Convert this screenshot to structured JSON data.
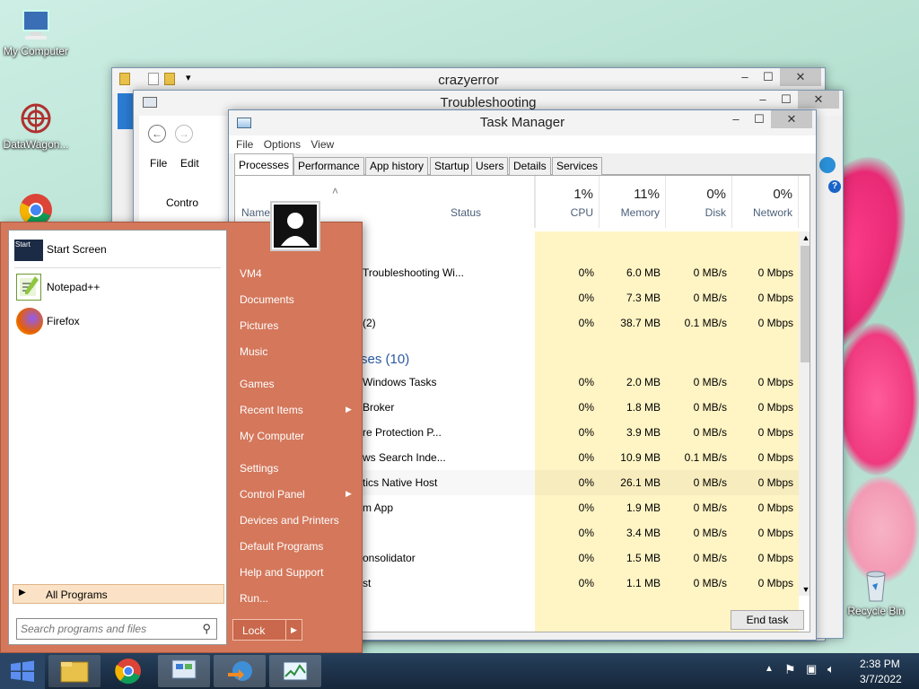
{
  "desktop": {
    "icons": [
      {
        "label": "My Computer",
        "icon": "computer-icon"
      },
      {
        "label": "DataWagon...",
        "icon": "datawagon-icon"
      },
      {
        "label": "",
        "icon": "chrome-icon"
      },
      {
        "label": "Recycle Bin",
        "icon": "recycle-bin-icon"
      }
    ]
  },
  "explorer_window": {
    "title": "crazyerror",
    "menu": [
      "File",
      "Edit"
    ],
    "sidebar_label": "Contro"
  },
  "troubleshooting_window": {
    "title": "Troubleshooting"
  },
  "task_manager": {
    "title": "Task Manager",
    "menu": [
      "File",
      "Options",
      "View"
    ],
    "tabs": [
      "Processes",
      "Performance",
      "App history",
      "Startup",
      "Users",
      "Details",
      "Services"
    ],
    "active_tab": "Processes",
    "columns": {
      "name": "Name",
      "status": "Status",
      "cpu": {
        "pct": "1%",
        "label": "CPU"
      },
      "memory": {
        "pct": "11%",
        "label": "Memory"
      },
      "disk": {
        "pct": "0%",
        "label": "Disk"
      },
      "network": {
        "pct": "0%",
        "label": "Network"
      }
    },
    "group_header": "ses (10)",
    "rows": [
      {
        "name": "Troubleshooting Wi...",
        "cpu": "0%",
        "memory": "6.0 MB",
        "disk": "0 MB/s",
        "network": "0 Mbps"
      },
      {
        "name": "",
        "cpu": "0%",
        "memory": "7.3 MB",
        "disk": "0 MB/s",
        "network": "0 Mbps"
      },
      {
        "name": "(2)",
        "cpu": "0%",
        "memory": "38.7 MB",
        "disk": "0.1 MB/s",
        "network": "0 Mbps"
      },
      {
        "name": "Windows Tasks",
        "cpu": "0%",
        "memory": "2.0 MB",
        "disk": "0 MB/s",
        "network": "0 Mbps"
      },
      {
        "name": "Broker",
        "cpu": "0%",
        "memory": "1.8 MB",
        "disk": "0 MB/s",
        "network": "0 Mbps"
      },
      {
        "name": "re Protection P...",
        "cpu": "0%",
        "memory": "3.9 MB",
        "disk": "0 MB/s",
        "network": "0 Mbps"
      },
      {
        "name": "ws Search Inde...",
        "cpu": "0%",
        "memory": "10.9 MB",
        "disk": "0.1 MB/s",
        "network": "0 Mbps"
      },
      {
        "name": "tics Native Host",
        "cpu": "0%",
        "memory": "26.1 MB",
        "disk": "0 MB/s",
        "network": "0 Mbps"
      },
      {
        "name": "m App",
        "cpu": "0%",
        "memory": "1.9 MB",
        "disk": "0 MB/s",
        "network": "0 Mbps"
      },
      {
        "name": "",
        "cpu": "0%",
        "memory": "3.4 MB",
        "disk": "0 MB/s",
        "network": "0 Mbps"
      },
      {
        "name": "onsolidator",
        "cpu": "0%",
        "memory": "1.5 MB",
        "disk": "0 MB/s",
        "network": "0 Mbps"
      },
      {
        "name": "st",
        "cpu": "0%",
        "memory": "1.1 MB",
        "disk": "0 MB/s",
        "network": "0 Mbps"
      }
    ],
    "end_task": "End task"
  },
  "start_menu": {
    "pinned": [
      {
        "label": "Start Screen",
        "icon": "start-screen-icon"
      },
      {
        "label": "Notepad++",
        "icon": "notepadpp-icon"
      },
      {
        "label": "Firefox",
        "icon": "firefox-icon"
      }
    ],
    "all_programs": "All Programs",
    "search_placeholder": "Search programs and files",
    "right_links": [
      "VM4",
      "Documents",
      "Pictures",
      "Music",
      "Games",
      "Recent Items",
      "My Computer",
      "Settings",
      "Control Panel",
      "Devices and Printers",
      "Default Programs",
      "Help and Support",
      "Run..."
    ],
    "lock": "Lock"
  },
  "taskbar": {
    "time": "2:38 PM",
    "date": "3/7/2022"
  }
}
